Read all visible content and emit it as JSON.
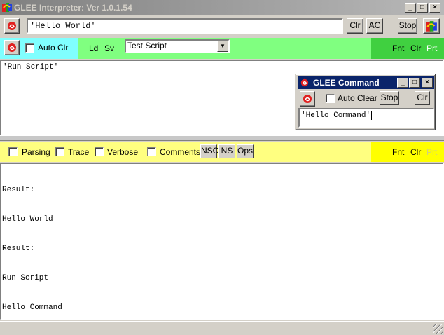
{
  "app": {
    "title": "GLEE Interpreter: Ver 1.0.1.54",
    "window_buttons": {
      "minimize": "_",
      "maximize": "□",
      "close": "×"
    }
  },
  "toolbar_top": {
    "command_value": "'Hello World'",
    "clr_label": "Clr",
    "ac_label": "AC",
    "stop_label": "Stop"
  },
  "script_bar": {
    "auto_clr_label": "Auto Clr",
    "ld_label": "Ld",
    "sv_label": "Sv",
    "script_selected": "Test Script",
    "fnt_label": "Fnt",
    "clr_label": "Clr",
    "prt_label": "Prt"
  },
  "script_area": {
    "text": "'Run Script'"
  },
  "command_window": {
    "title": "GLEE Command",
    "auto_clear_label": "Auto Clear",
    "stop_label": "Stop",
    "clr_label": "Clr",
    "input_value": "'Hello Command'"
  },
  "output_bar": {
    "parsing_label": "Parsing",
    "trace_label": "Trace",
    "verbose_label": "Verbose",
    "comments_label": "Comments",
    "nsc_label": "NSC",
    "ns_label": "NS",
    "ops_label": "Ops",
    "fnt_label": "Fnt",
    "clr_label": "Clr",
    "prt_label": "Prt"
  },
  "output": {
    "lines": [
      "Result:",
      "Hello World",
      "Result:",
      "Run Script",
      "Hello Command"
    ]
  },
  "colors": {
    "script_bar": "#80ff80",
    "script_bar_left": "#80ffff",
    "script_bar_right": "#40d040",
    "output_bar": "#ffff80",
    "output_bar_right": "#ffff00",
    "cmd_titlebar": "#0a246a"
  },
  "icons": [
    "glee-app-icon",
    "red-swirl-icon",
    "checkbox-icon",
    "dropdown-arrow-icon",
    "resize-grip-icon"
  ]
}
